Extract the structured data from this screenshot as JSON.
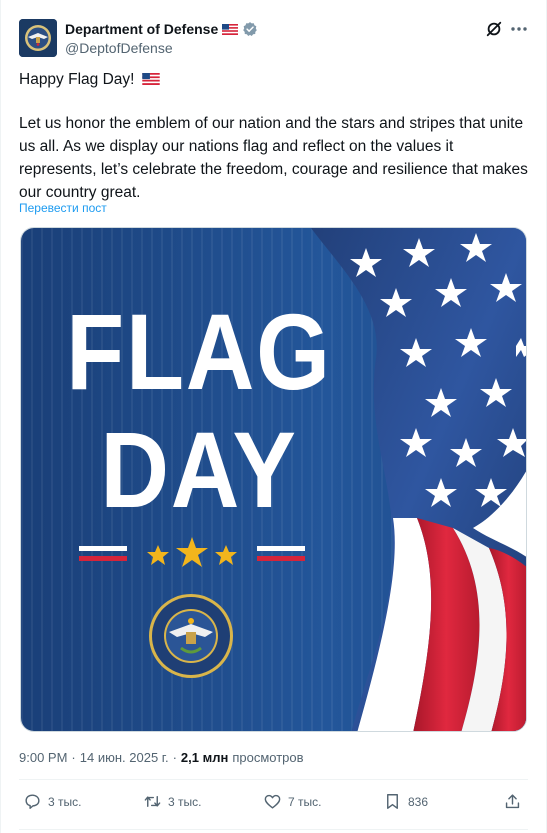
{
  "post": {
    "author_name": "Department of Defense",
    "author_handle": "@DeptofDefense",
    "flag_emoji_name": "us-flag-emoji",
    "text_line1": "Happy Flag Day!",
    "text_paragraph": "Let us honor the emblem of our nation and the stars and stripes that unite us all. As we display our nations flag and reflect on the values it represents, let’s celebrate the freedom, courage and resilience that makes our country great.",
    "translate_label": "Перевести пост"
  },
  "media": {
    "headline_line1": "FLAG",
    "headline_line2": "DAY",
    "seal_text": "DEPARTMENT OF DEFENSE · UNITED STATES OF AMERICA",
    "colors": {
      "navy": "#1f4a86",
      "red": "#d6243a",
      "gold": "#f2b51c"
    }
  },
  "meta": {
    "time": "9:00 PM",
    "separator": "·",
    "date": "14 июн. 2025 г.",
    "views_count": "2,1 млн",
    "views_label": "просмотров"
  },
  "actions": {
    "replies": "3 тыс.",
    "reposts": "3 тыс.",
    "likes": "7 тыс.",
    "bookmarks": "836"
  },
  "colors": {
    "accent": "#1d9bf0",
    "verified": "#829aab",
    "muted": "#536471"
  }
}
